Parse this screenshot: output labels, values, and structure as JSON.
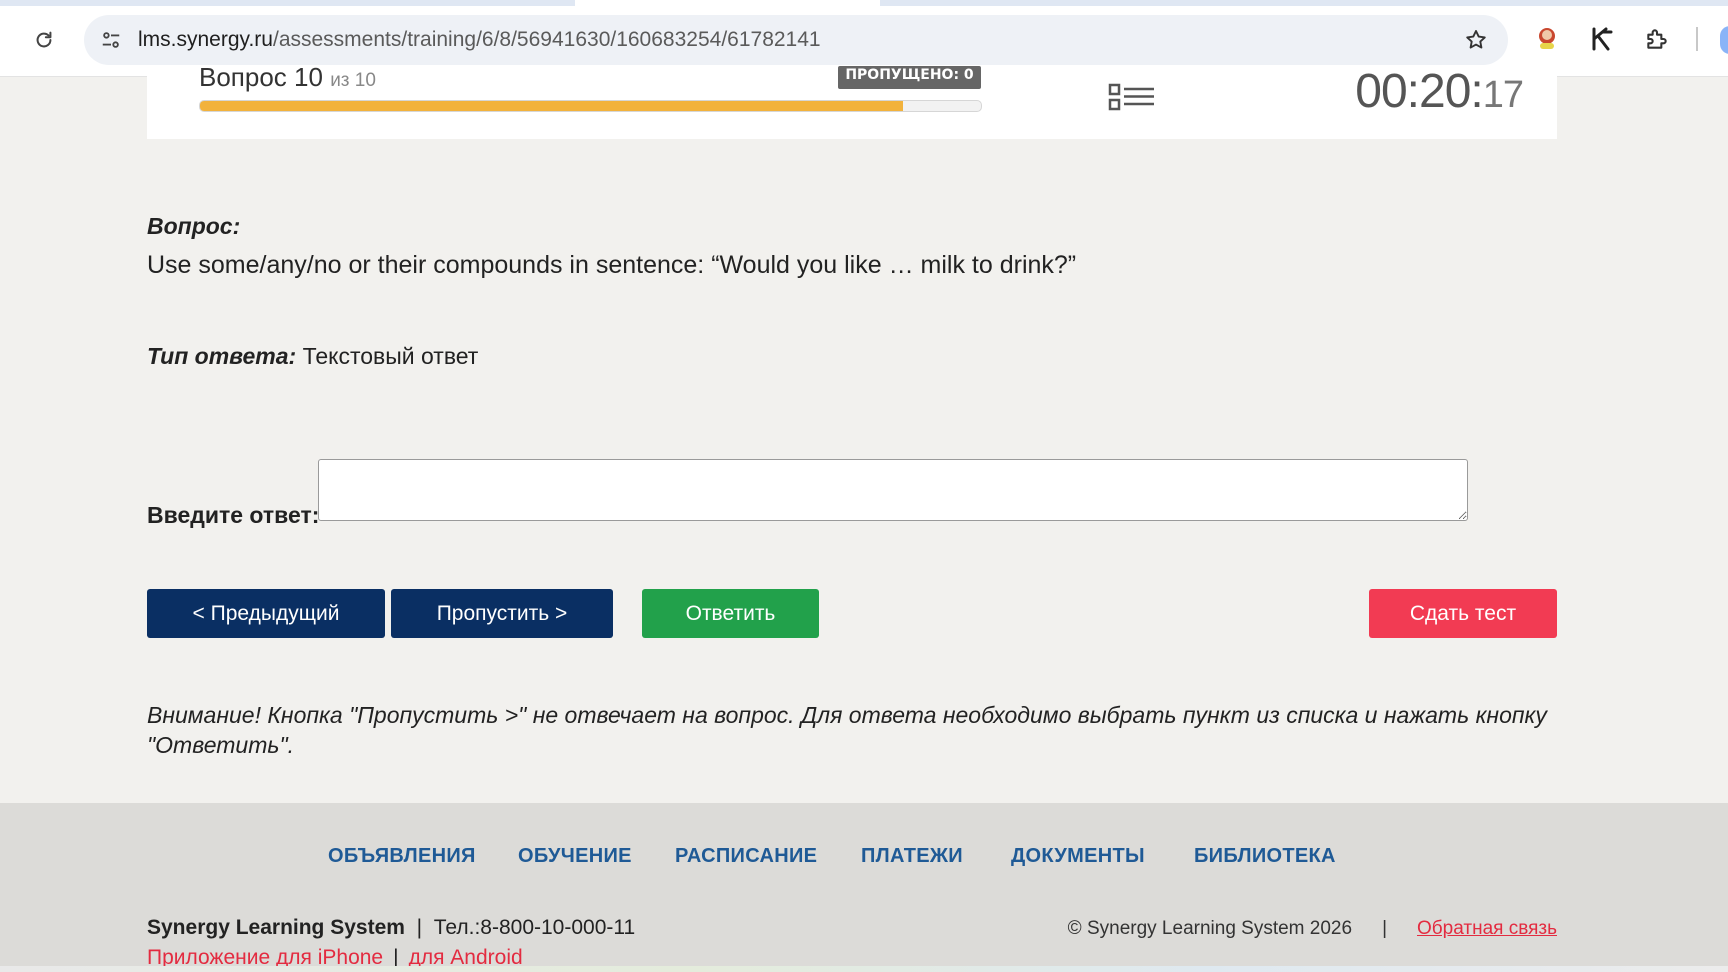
{
  "browser": {
    "url_host": "lms.synergy.ru",
    "url_path": "/assessments/training/6/8/56941630/160683254/61782141",
    "colors": {
      "tab_bar": "#dfe7f3",
      "omnibox": "#eef1f6"
    }
  },
  "header": {
    "question_label": "Вопрос 10",
    "question_of": "из 10",
    "skipped_badge": "ПРОПУЩЕНО: 0",
    "progress": 0.9,
    "timer_main": "00:20:",
    "timer_seconds": "17",
    "progress_color": "#f2b23c"
  },
  "question": {
    "label": "Вопрос:",
    "text": "Use some/any/no or their compounds in sentence: “Would you like … milk to drink?”"
  },
  "answer_type": {
    "label": "Тип ответа:",
    "value": "Текстовый ответ"
  },
  "answer": {
    "label": "Введите ответ:",
    "value": ""
  },
  "buttons": {
    "prev": "< Предыдущий",
    "skip": "Пропустить >",
    "answer": "Ответить",
    "submit": "Сдать тест",
    "colors": {
      "nav": "#0a2f63",
      "answer": "#22a14b",
      "submit": "#f23b53"
    }
  },
  "warning": "Внимание! Кнопка \"Пропустить >\" не отвечает на вопрос. Для ответа необходимо выбрать пункт из списка и нажать кнопку \"Ответить\".",
  "footer": {
    "nav": [
      "ОБЪЯВЛЕНИЯ",
      "ОБУЧЕНИЕ",
      "РАСПИСАНИЕ",
      "ПЛАТЕЖИ",
      "ДОКУМЕНТЫ",
      "БИБЛИОТЕКА"
    ],
    "brand": "Synergy Learning System",
    "phone": "Тел.:8-800-10-000-11",
    "iphone_link": "Приложение для iPhone",
    "android_link": "для Android",
    "copyright": "© Synergy Learning System 2026",
    "feedback": "Обратная связь",
    "nav_color": "#1f5a96",
    "link_color": "#e32b40"
  }
}
